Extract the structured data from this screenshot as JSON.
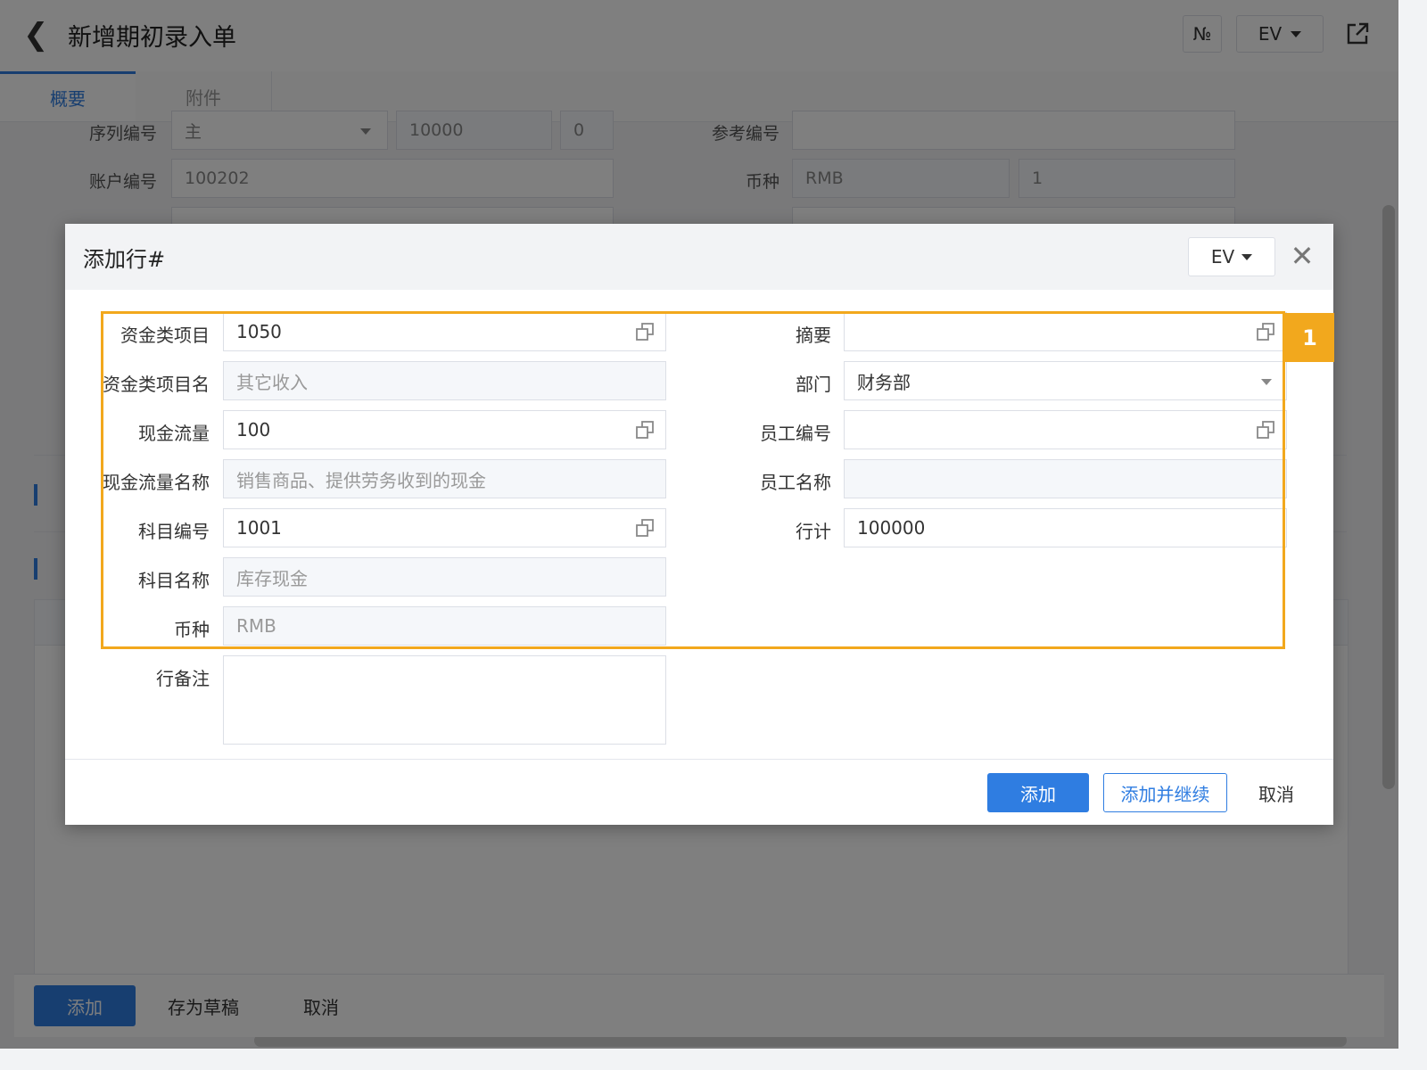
{
  "header": {
    "title": "新增期初录入单",
    "no_button": "№",
    "ev_button": "EV"
  },
  "tabs": [
    {
      "label": "概要"
    },
    {
      "label": "附件"
    }
  ],
  "background_form": {
    "serial_label": "序列编号",
    "serial_value": "主",
    "serial_start": "10000",
    "serial_step": "0",
    "ref_label": "参考编号",
    "account_label": "账户编号",
    "account_value": "100202",
    "currency_label": "币种",
    "currency_value": "RMB",
    "rate_value": "1"
  },
  "dialog": {
    "title": "添加行#",
    "ev_label": "EV",
    "left_fields": [
      {
        "label": "资金类项目",
        "value": "1050",
        "readonly": false
      },
      {
        "label": "资金类项目名",
        "value": "其它收入",
        "readonly": true
      },
      {
        "label": "现金流量",
        "value": "100",
        "readonly": false
      },
      {
        "label": "现金流量名称",
        "value": "销售商品、提供劳务收到的现金",
        "readonly": true
      },
      {
        "label": "科目编号",
        "value": "1001",
        "readonly": false
      },
      {
        "label": "科目名称",
        "value": "库存现金",
        "readonly": true
      },
      {
        "label": "币种",
        "value": "RMB",
        "readonly": true
      }
    ],
    "remark_label": "行备注",
    "right_fields": [
      {
        "label": "摘要",
        "value": ""
      },
      {
        "label": "部门",
        "value": "财务部"
      },
      {
        "label": "员工编号",
        "value": ""
      },
      {
        "label": "员工名称",
        "value": ""
      },
      {
        "label": "行计",
        "value": "100000"
      }
    ],
    "buttons": {
      "add": "添加",
      "add_continue": "添加并继续",
      "cancel": "取消"
    }
  },
  "highlight": {
    "badge": "1"
  },
  "footer": {
    "add": "添加",
    "save_draft": "存为草稿",
    "cancel": "取消"
  }
}
